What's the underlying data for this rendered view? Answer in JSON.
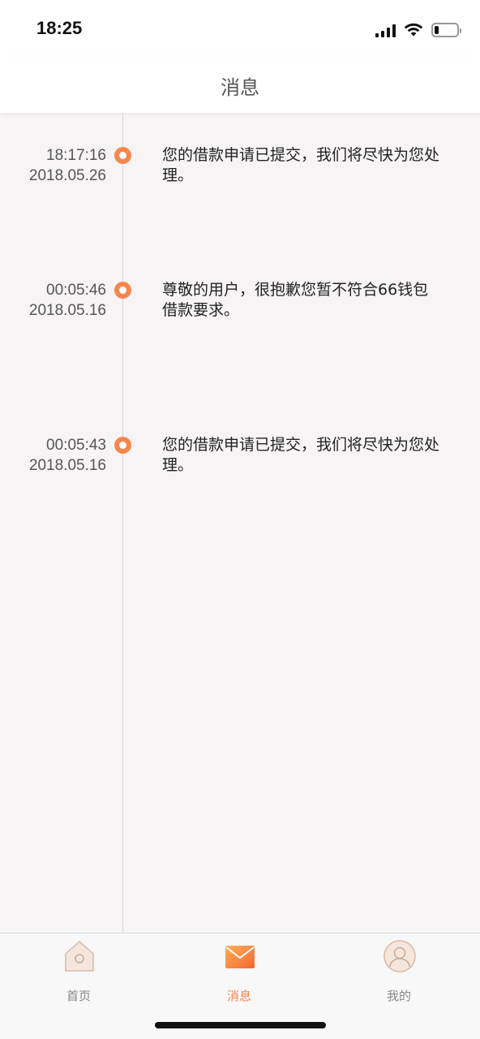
{
  "status_bar": {
    "time": "18:25"
  },
  "nav": {
    "title": "消息"
  },
  "messages": [
    {
      "time": "18:17:16",
      "date": "2018.05.26",
      "text": "您的借款申请已提交，我们将尽快为您处理。"
    },
    {
      "time": "00:05:46",
      "date": "2018.05.16",
      "text": "尊敬的用户，很抱歉您暂不符合66钱包借款要求。"
    },
    {
      "time": "00:05:43",
      "date": "2018.05.16",
      "text": "您的借款申请已提交，我们将尽快为您处理。"
    }
  ],
  "tabs": [
    {
      "label": "首页",
      "icon": "home-icon",
      "active": false
    },
    {
      "label": "消息",
      "icon": "mail-icon",
      "active": true
    },
    {
      "label": "我的",
      "icon": "user-icon",
      "active": false
    }
  ],
  "colors": {
    "accent": "#f5874e",
    "background": "#f6f4f5"
  },
  "battery_level": 0.2
}
